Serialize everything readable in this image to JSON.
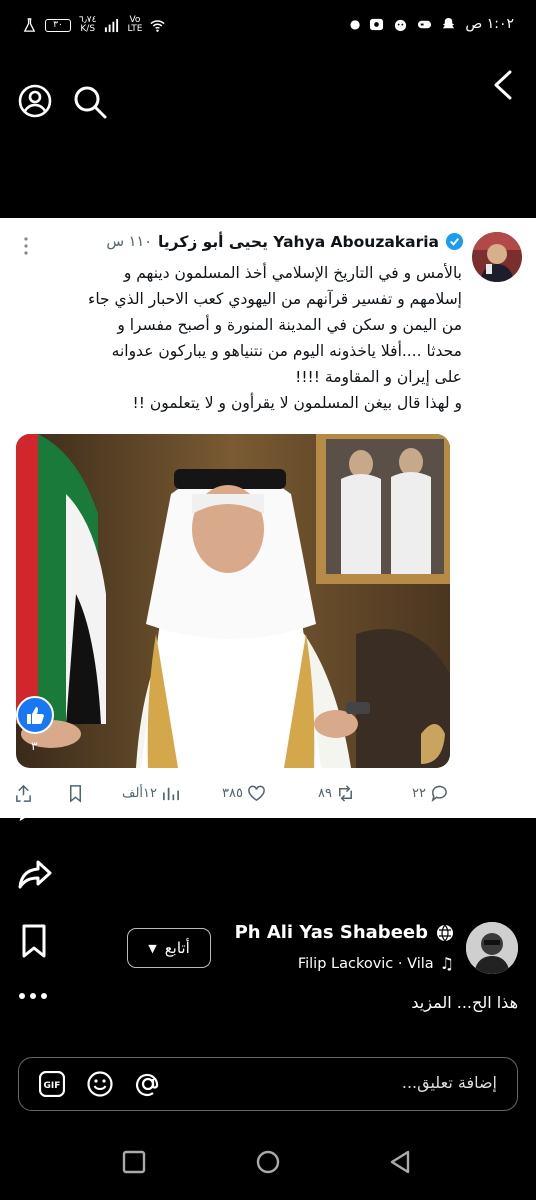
{
  "status_bar": {
    "time": "١:٠٢ ص",
    "battery": "٣٠",
    "net_speed": "٦٫٧٤",
    "net_unit": "K/S",
    "carrier_line1": "Vo",
    "carrier_line2": "LTE"
  },
  "tweet": {
    "author_name": "Yahya Abouzakaria يحيى أبو زكريا",
    "time": "١١٠ س",
    "text": "بالأمس و في التاريخ الإسلامي أخذ المسلمون دينهم و\nإسلامهم و تفسير قرآنهم من اليهودي كعب الاحبار الذي جاء\nمن اليمن و سكن في المدينة المنورة  و أصبح مفسرا و\nمحدثا ....أفلا ياخذونه اليوم من نتنياهو و يباركون عدوانه\nعلى إيران و المقاومة !!!!\nو لهذا قال بيغن المسلمون لا يقرأون و لا يتعلمون !!",
    "reaction_count": "٣",
    "actions": {
      "replies": "٢٢",
      "retweets": "٨٩",
      "likes": "٣٨٥",
      "views": "١٢ألف"
    }
  },
  "reel": {
    "author_name": "Ph Ali Yas Shabeeb",
    "music": "Filip Lackovic · Vila",
    "follow_label": "أتابع",
    "caption": "هذا الح... المزيد"
  },
  "comment": {
    "placeholder": "إضافة تعليق..."
  },
  "colors": {
    "verified": "#1d9bf0",
    "like_bubble": "#1877f2",
    "muted": "#536471"
  }
}
